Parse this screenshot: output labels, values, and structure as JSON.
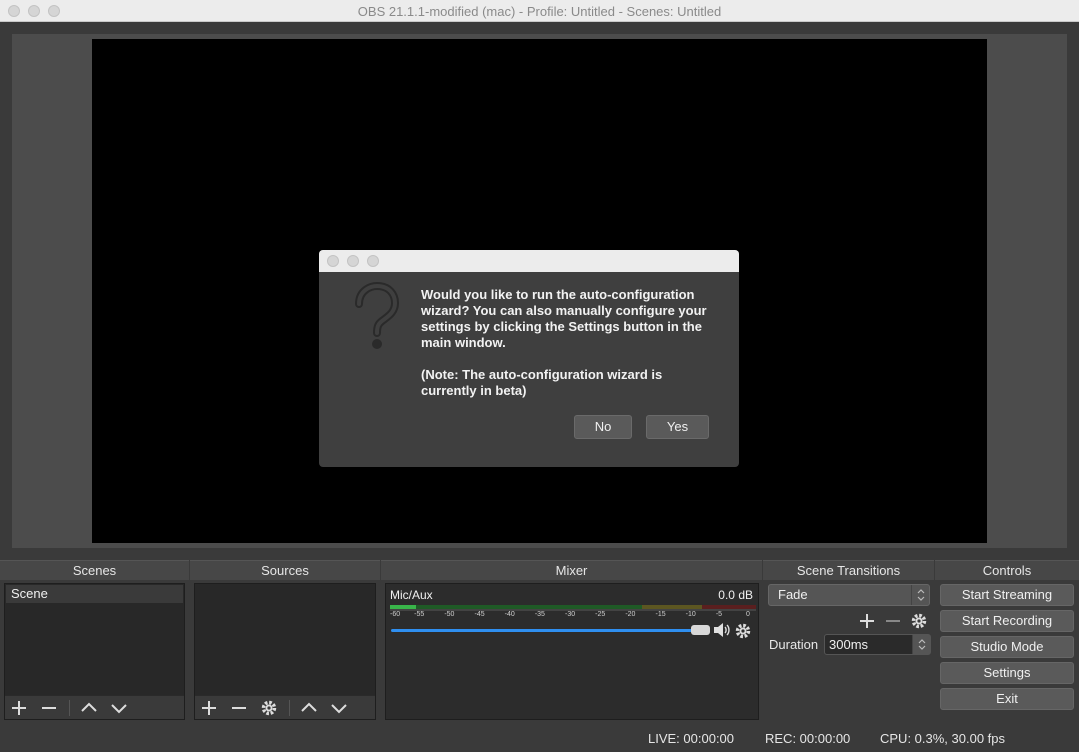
{
  "window": {
    "title": "OBS 21.1.1-modified (mac) - Profile: Untitled - Scenes: Untitled"
  },
  "dialog": {
    "message": "Would you like to run the auto-configuration wizard?  You can also manually configure your settings by clicking the Settings button in the main window.",
    "note": "(Note: The auto-configuration wizard is currently in beta)",
    "no_label": "No",
    "yes_label": "Yes",
    "icon": "question-icon"
  },
  "panels": {
    "scenes": {
      "header": "Scenes",
      "items": [
        "Scene"
      ]
    },
    "sources": {
      "header": "Sources"
    },
    "mixer": {
      "header": "Mixer",
      "channel": "Mic/Aux",
      "level": "0.0 dB",
      "ticks": [
        "-60",
        "-55",
        "-50",
        "-45",
        "-40",
        "-35",
        "-30",
        "-25",
        "-20",
        "-15",
        "-10",
        "-5",
        "0"
      ]
    },
    "transitions": {
      "header": "Scene Transitions",
      "selected": "Fade",
      "duration_label": "Duration",
      "duration_value": "300ms"
    },
    "controls": {
      "header": "Controls",
      "start_streaming": "Start Streaming",
      "start_recording": "Start Recording",
      "studio_mode": "Studio Mode",
      "settings": "Settings",
      "exit": "Exit"
    }
  },
  "status": {
    "live": "LIVE: 00:00:00",
    "rec": "REC: 00:00:00",
    "cpu": "CPU: 0.3%, 30.00 fps"
  },
  "colors": {
    "meter_green": "#39b54a",
    "meter_yellow": "#c9b53a",
    "meter_red": "#c03a3a",
    "slider_blue": "#2f8ff0"
  }
}
